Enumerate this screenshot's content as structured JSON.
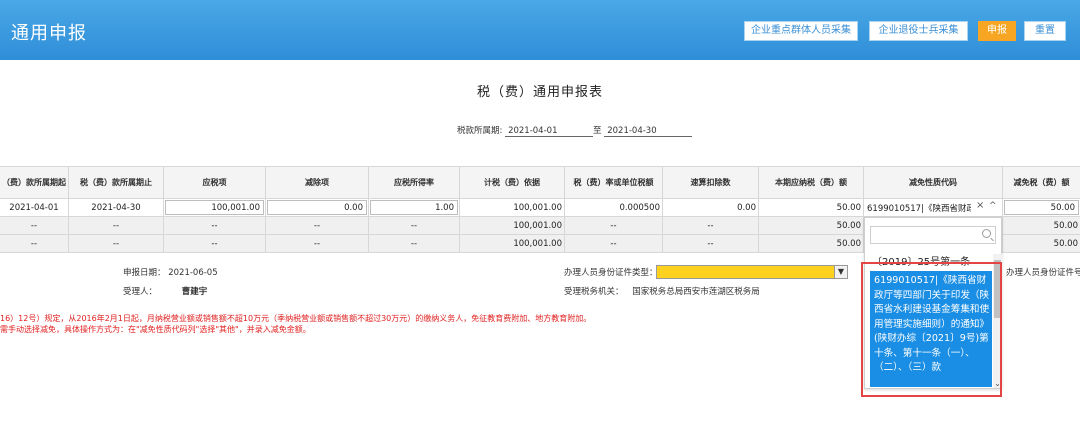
{
  "header": {
    "title": "通用申报",
    "buttons": {
      "key_groups": "企业重点群体人员采集",
      "veterans": "企业退役士兵采集",
      "declare": "申报",
      "reset": "重置"
    }
  },
  "form": {
    "title": "税（费）通用申报表",
    "period_label": "税款所属期:",
    "period_start": "2021-04-01",
    "period_to": "至",
    "period_end": "2021-04-30"
  },
  "table": {
    "headers": [
      "（费）款所属期起",
      "税（费）款所属期止",
      "应税项",
      "减除项",
      "应税所得率",
      "计税（费）依据",
      "税（费）率或单位税额",
      "速算扣除数",
      "本期应纳税（费）额",
      "减免性质代码",
      "减免税（费）额"
    ],
    "rows": [
      [
        "2021-04-01",
        "2021-04-30",
        "100,001.00",
        "0.00",
        "1.00",
        "100,001.00",
        "0.000500",
        "0.00",
        "50.00",
        "",
        "50.00"
      ],
      [
        "--",
        "--",
        "--",
        "--",
        "--",
        "100,001.00",
        "--",
        "--",
        "50.00",
        "",
        "50.00"
      ],
      [
        "--",
        "--",
        "--",
        "--",
        "--",
        "100,001.00",
        "--",
        "--",
        "50.00",
        "",
        "50.00"
      ]
    ]
  },
  "reduction_dropdown": {
    "selected": "6199010517|《陕西省财政厅",
    "clear_icon": "×",
    "caret_icon": "^",
    "search_placeholder": "",
    "option_partial": "〔2019〕25号第一条",
    "option_highlighted": "6199010517|《陕西省财政厅等四部门关于印发（陕西省水利建设基金筹集和使用管理实施细则）的通知》(陕财办综〔2021〕9号)第十条、第十一条（一）、（二）、（三）款"
  },
  "footer_info": {
    "declare_date_label": "申报日期：",
    "declare_date": "2021-06-05",
    "receiver_label": "受理人：",
    "receiver": "曹建宇",
    "id_type_label": "办理人员身份证件类型：",
    "id_type_value": "",
    "authority_label": "受理税务机关：",
    "authority": "国家税务总局西安市莲湖区税务局",
    "right_cut_label": "办理人员身份证件号码"
  },
  "notes": [
    "16）12号）规定，从2016年2月1日起，月纳税营业额或销售额不超10万元（季纳税营业额或销售额不超过30万元）的缴纳义务人，免征教育费附加、地方教育附加。",
    "需手动选择减免，具体操作方式为：在\"减免性质代码列\"选择\"其他\"，并录入减免金额。"
  ]
}
